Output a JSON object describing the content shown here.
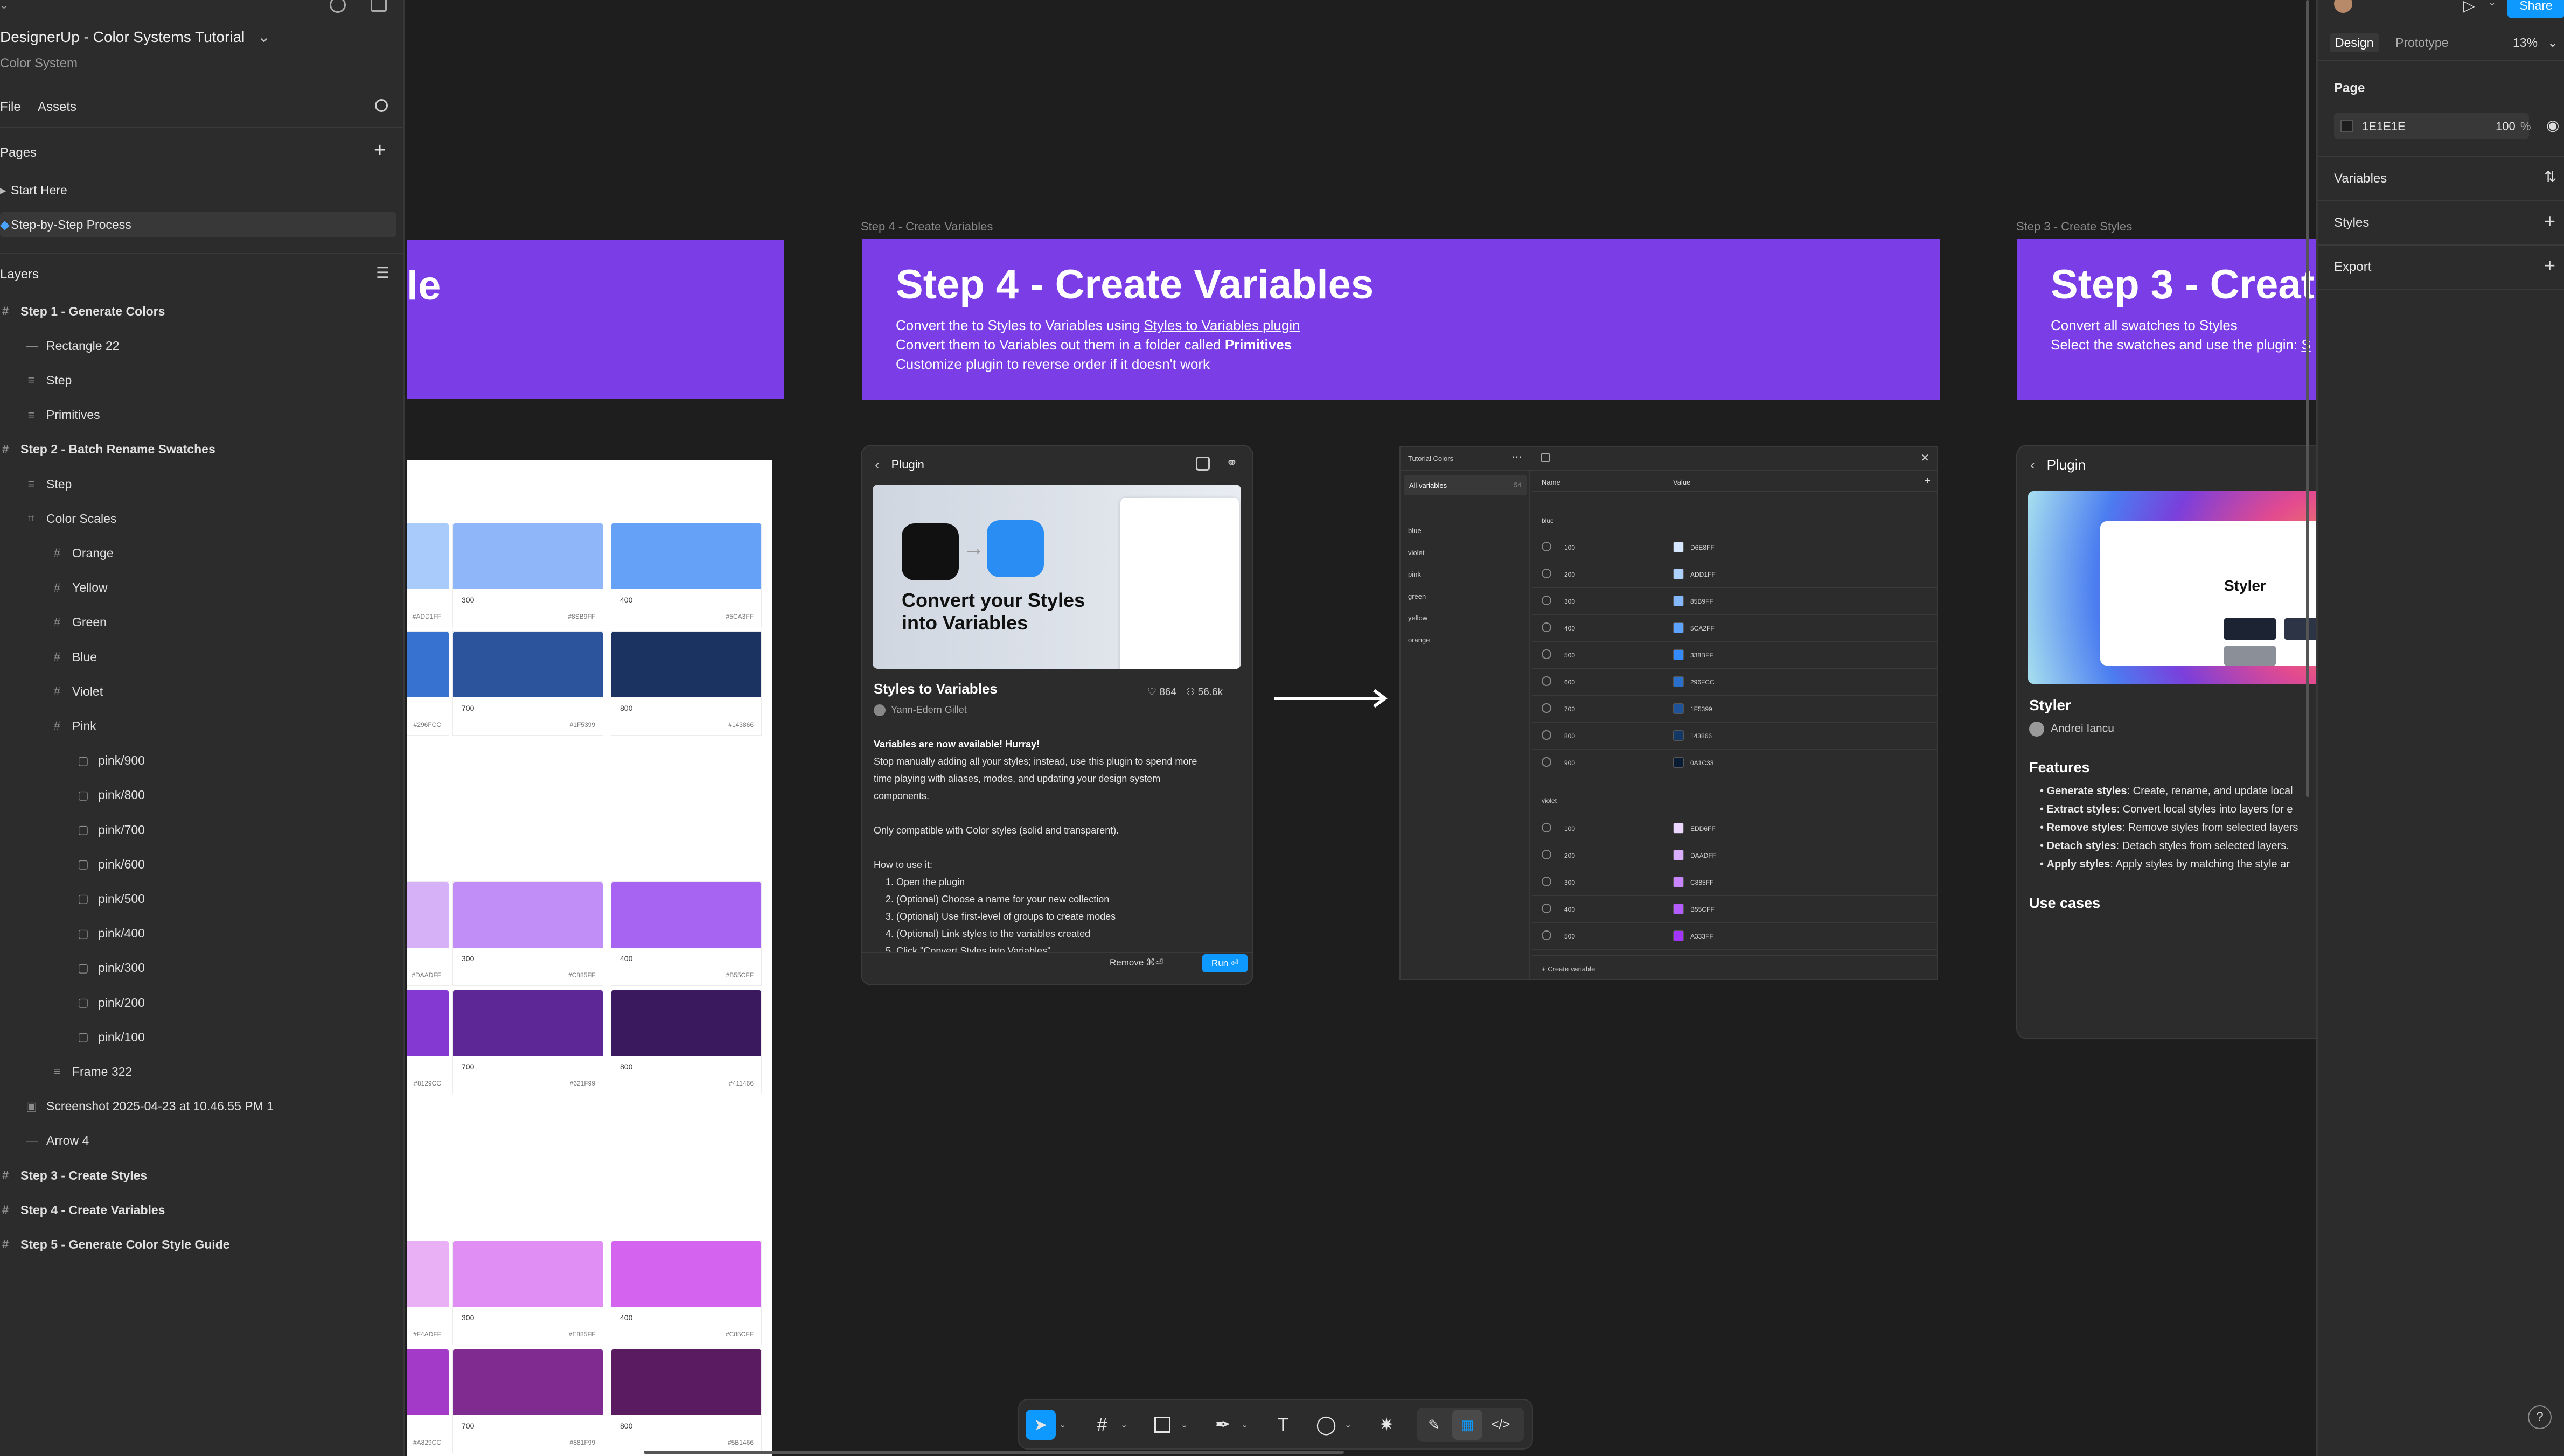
{
  "left_panel": {
    "file_title": "DesignerUp - Color Systems Tutorial",
    "file_subtitle": "Color System",
    "tabs": {
      "file": "File",
      "assets": "Assets"
    },
    "pages_heading": "Pages",
    "pages": [
      "Start Here",
      "Step-by-Step Process"
    ],
    "layers_heading": "Layers",
    "layers": [
      {
        "label": "Step 1 - Generate Colors",
        "indent": 0,
        "bold": true,
        "icon": "frame-icon"
      },
      {
        "label": "Rectangle 22",
        "indent": 1,
        "bold": false,
        "icon": "line-icon"
      },
      {
        "label": "Step",
        "indent": 1,
        "bold": false,
        "icon": "text-frame-icon"
      },
      {
        "label": "Primitives",
        "indent": 1,
        "bold": false,
        "icon": "text-frame-icon"
      },
      {
        "label": "Step 2 - Batch Rename Swatches",
        "indent": 0,
        "bold": true,
        "icon": "frame-icon"
      },
      {
        "label": "Step",
        "indent": 1,
        "bold": false,
        "icon": "text-frame-icon"
      },
      {
        "label": "Color Scales",
        "indent": 1,
        "bold": false,
        "icon": "grid-icon"
      },
      {
        "label": "Orange",
        "indent": 2,
        "bold": false,
        "icon": "frame-icon"
      },
      {
        "label": "Yellow",
        "indent": 2,
        "bold": false,
        "icon": "frame-icon"
      },
      {
        "label": "Green",
        "indent": 2,
        "bold": false,
        "icon": "frame-icon"
      },
      {
        "label": "Blue",
        "indent": 2,
        "bold": false,
        "icon": "frame-icon"
      },
      {
        "label": "Violet",
        "indent": 2,
        "bold": false,
        "icon": "frame-icon"
      },
      {
        "label": "Pink",
        "indent": 2,
        "bold": false,
        "icon": "frame-icon"
      },
      {
        "label": "pink/900",
        "indent": 3,
        "bold": false,
        "icon": "rectangle-icon"
      },
      {
        "label": "pink/800",
        "indent": 3,
        "bold": false,
        "icon": "rectangle-icon"
      },
      {
        "label": "pink/700",
        "indent": 3,
        "bold": false,
        "icon": "rectangle-icon"
      },
      {
        "label": "pink/600",
        "indent": 3,
        "bold": false,
        "icon": "rectangle-icon"
      },
      {
        "label": "pink/500",
        "indent": 3,
        "bold": false,
        "icon": "rectangle-icon"
      },
      {
        "label": "pink/400",
        "indent": 3,
        "bold": false,
        "icon": "rectangle-icon"
      },
      {
        "label": "pink/300",
        "indent": 3,
        "bold": false,
        "icon": "rectangle-icon"
      },
      {
        "label": "pink/200",
        "indent": 3,
        "bold": false,
        "icon": "rectangle-icon"
      },
      {
        "label": "pink/100",
        "indent": 3,
        "bold": false,
        "icon": "rectangle-icon"
      },
      {
        "label": "Frame 322",
        "indent": 2,
        "bold": false,
        "icon": "text-frame-icon"
      },
      {
        "label": "Screenshot 2025-04-23 at 10.46.55 PM 1",
        "indent": 1,
        "bold": false,
        "icon": "image-icon"
      },
      {
        "label": "Arrow 4",
        "indent": 1,
        "bold": false,
        "icon": "line-icon"
      },
      {
        "label": "Step 3 - Create Styles",
        "indent": 0,
        "bold": true,
        "icon": "frame-icon"
      },
      {
        "label": "Step 4 - Create Variables",
        "indent": 0,
        "bold": true,
        "icon": "frame-icon"
      },
      {
        "label": "Step 5 - Generate Color Style Guide",
        "indent": 0,
        "bold": true,
        "icon": "frame-icon"
      }
    ]
  },
  "canvas": {
    "banner_left_fragment": "le",
    "step4": {
      "frame_label": "Step 4 - Create Variables",
      "title": "Step 4 - Create Variables",
      "line1_pre": "Convert the to Styles to Variables using ",
      "line1_link": "Styles to Variables plugin",
      "line2_pre": "Convert them to Variables out them in a folder called ",
      "line2_bold": "Primitives",
      "line3": "Customize plugin to reverse order if it doesn't work"
    },
    "step3": {
      "frame_label": "Step 3 - Create Styles",
      "title": "Step 3 - Creat",
      "line1": "Convert all swatches to Styles",
      "line2_pre": "Select the swatches and use the plugin: ",
      "line2_link": "S"
    },
    "swatches": [
      {
        "name": "",
        "hex": "#ADD1FF",
        "color": "#a9cbfb"
      },
      {
        "name": "300",
        "hex": "#8SB9FF",
        "color": "#8fb6f8"
      },
      {
        "name": "400",
        "hex": "#5CA3FF",
        "color": "#64a1f7"
      },
      {
        "name": "",
        "hex": "#296FCC",
        "color": "#3772d0"
      },
      {
        "name": "700",
        "hex": "#1F5399",
        "color": "#2b549d"
      },
      {
        "name": "800",
        "hex": "#143866",
        "color": "#1b3361"
      },
      {
        "name": "",
        "hex": "#DAADFF",
        "color": "#d7b1f7"
      },
      {
        "name": "300",
        "hex": "#C885FF",
        "color": "#c18df6"
      },
      {
        "name": "400",
        "hex": "#B55CFF",
        "color": "#a763f2"
      },
      {
        "name": "",
        "hex": "#8129CC",
        "color": "#8339d2"
      },
      {
        "name": "700",
        "hex": "#621F99",
        "color": "#5d2796"
      },
      {
        "name": "800",
        "hex": "#411466",
        "color": "#3b195e"
      },
      {
        "name": "",
        "hex": "#F4ADFF",
        "color": "#eab0f6"
      },
      {
        "name": "300",
        "hex": "#E885FF",
        "color": "#e08df4"
      },
      {
        "name": "400",
        "hex": "#C85CFF",
        "color": "#d464f0"
      },
      {
        "name": "",
        "hex": "#A829CC",
        "color": "#a33ac8"
      },
      {
        "name": "700",
        "hex": "#881F99",
        "color": "#7f2b8f"
      },
      {
        "name": "800",
        "hex": "#5B1466",
        "color": "#5b1b60"
      }
    ],
    "plugin_left": {
      "header": "Plugin",
      "hero_title": "Convert your Styles into Variables",
      "name": "Styles to Variables",
      "likes": "864",
      "users": "56.6k",
      "author": "Yann-Edern Gillet",
      "desc_bold": "Variables are now available! Hurray!",
      "desc1": "Stop manually adding all your styles; instead, use this plugin to spend more",
      "desc2": "time playing with aliases, modes, and updating your design system",
      "desc3": "components.",
      "desc4": "Only compatible with Color styles (solid and transparent).",
      "howto": "How to use it:",
      "steps": [
        "1. Open the plugin",
        "2. (Optional) Choose a name for your new collection",
        "3. (Optional) Use first-level of groups to create modes",
        "4. (Optional) Link styles to the variables created",
        "5. Click \"Convert Styles into Variables\""
      ],
      "remove_label": "Remove ⌘⏎",
      "run_label": "Run ⏎"
    },
    "variables_panel": {
      "collection": "Tutorial Colors",
      "all_variables": "All variables",
      "count": "54",
      "groups": [
        "blue",
        "violet",
        "pink",
        "green",
        "yellow",
        "orange"
      ],
      "col_name": "Name",
      "col_value": "Value",
      "blue_label": "blue",
      "violet_label": "violet",
      "blue_rows": [
        {
          "n": "100",
          "v": "D6E8FF",
          "c": "#d6e8ff"
        },
        {
          "n": "200",
          "v": "ADD1FF",
          "c": "#add1ff"
        },
        {
          "n": "300",
          "v": "85B9FF",
          "c": "#85b9ff"
        },
        {
          "n": "400",
          "v": "5CA2FF",
          "c": "#5ca2ff"
        },
        {
          "n": "500",
          "v": "338BFF",
          "c": "#338bff"
        },
        {
          "n": "600",
          "v": "296FCC",
          "c": "#296fcc"
        },
        {
          "n": "700",
          "v": "1F5399",
          "c": "#1f5399"
        },
        {
          "n": "800",
          "v": "143866",
          "c": "#143866"
        },
        {
          "n": "900",
          "v": "0A1C33",
          "c": "#0a1c33"
        }
      ],
      "violet_rows": [
        {
          "n": "100",
          "v": "EDD6FF",
          "c": "#edd6ff"
        },
        {
          "n": "200",
          "v": "DAADFF",
          "c": "#daadff"
        },
        {
          "n": "300",
          "v": "C885FF",
          "c": "#c885ff"
        },
        {
          "n": "400",
          "v": "B55CFF",
          "c": "#b55cff"
        },
        {
          "n": "500",
          "v": "A333FF",
          "c": "#a333ff"
        }
      ],
      "create_variable": "Create variable"
    },
    "plugin_right": {
      "header": "Plugin",
      "hero_title": "Styler",
      "name": "Styler",
      "author": "Andrei Iancu",
      "features_heading": "Features",
      "features": [
        {
          "b": "Generate styles",
          "t": ": Create, rename, and update local"
        },
        {
          "b": "Extract styles",
          "t": ": Convert local styles into layers for e"
        },
        {
          "b": "Remove styles",
          "t": ": Remove styles from selected layers"
        },
        {
          "b": "Detach styles",
          "t": ": Detach styles from selected layers."
        },
        {
          "b": "Apply styles",
          "t": ": Apply styles by matching the style ar"
        }
      ],
      "use_cases": "Use cases"
    }
  },
  "right_panel": {
    "share": "Share",
    "tabs": {
      "design": "Design",
      "prototype": "Prototype"
    },
    "zoom": "13%",
    "page_heading": "Page",
    "page_color": "1E1E1E",
    "page_opacity": "100",
    "percent": "%",
    "variables": "Variables",
    "styles": "Styles",
    "export": "Export"
  },
  "colors": {
    "accent": "#7b3ee6",
    "primary_button": "#0d99ff",
    "canvas": "#1e1e1e",
    "panel": "#2c2c2c"
  }
}
